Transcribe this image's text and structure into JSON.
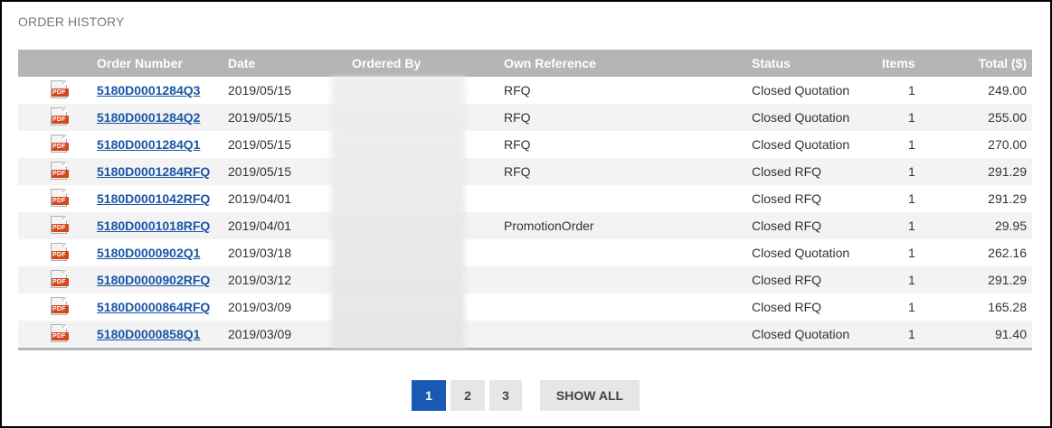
{
  "title": "ORDER HISTORY",
  "columns": {
    "order_number": "Order Number",
    "date": "Date",
    "ordered_by": "Ordered By",
    "own_reference": "Own Reference",
    "status": "Status",
    "items": "Items",
    "total": "Total ($)"
  },
  "pdf_icon_text": "PDF",
  "orders": [
    {
      "number": "5180D0001284Q3",
      "date": "2019/05/15",
      "ref": "RFQ",
      "status": "Closed Quotation",
      "items": "1",
      "total": "249.00"
    },
    {
      "number": "5180D0001284Q2",
      "date": "2019/05/15",
      "ref": "RFQ",
      "status": "Closed Quotation",
      "items": "1",
      "total": "255.00"
    },
    {
      "number": "5180D0001284Q1",
      "date": "2019/05/15",
      "ref": "RFQ",
      "status": "Closed Quotation",
      "items": "1",
      "total": "270.00"
    },
    {
      "number": "5180D0001284RFQ",
      "date": "2019/05/15",
      "ref": "RFQ",
      "status": "Closed RFQ",
      "items": "1",
      "total": "291.29"
    },
    {
      "number": "5180D0001042RFQ",
      "date": "2019/04/01",
      "ref": "",
      "status": "Closed RFQ",
      "items": "1",
      "total": "291.29"
    },
    {
      "number": "5180D0001018RFQ",
      "date": "2019/04/01",
      "ref": "PromotionOrder",
      "status": "Closed RFQ",
      "items": "1",
      "total": "29.95"
    },
    {
      "number": "5180D0000902Q1",
      "date": "2019/03/18",
      "ref": "",
      "status": "Closed Quotation",
      "items": "1",
      "total": "262.16"
    },
    {
      "number": "5180D0000902RFQ",
      "date": "2019/03/12",
      "ref": "",
      "status": "Closed RFQ",
      "items": "1",
      "total": "291.29"
    },
    {
      "number": "5180D0000864RFQ",
      "date": "2019/03/09",
      "ref": "",
      "status": "Closed RFQ",
      "items": "1",
      "total": "165.28"
    },
    {
      "number": "5180D0000858Q1",
      "date": "2019/03/09",
      "ref": "",
      "status": "Closed Quotation",
      "items": "1",
      "total": "91.40"
    }
  ],
  "pagination": {
    "pages": [
      "1",
      "2",
      "3"
    ],
    "current": "1",
    "show_all": "SHOW ALL"
  },
  "colors": {
    "header_bg": "#b5b5b5",
    "link": "#1a56a8",
    "active_page": "#1a5ab5",
    "pdf_red": "#d4471f"
  }
}
